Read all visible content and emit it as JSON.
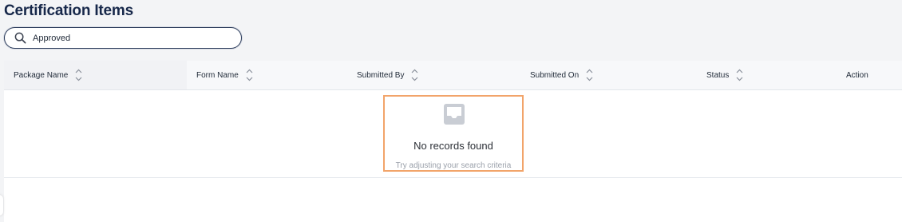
{
  "page": {
    "title": "Certification Items"
  },
  "search": {
    "value": "Approved"
  },
  "table": {
    "columns": [
      {
        "label": "Package Name",
        "sortable": true
      },
      {
        "label": "Form Name",
        "sortable": true
      },
      {
        "label": "Submitted By",
        "sortable": true
      },
      {
        "label": "Submitted On",
        "sortable": true
      },
      {
        "label": "Status",
        "sortable": true
      },
      {
        "label": "Action",
        "sortable": false
      }
    ],
    "rows": [],
    "empty": {
      "title": "No records found",
      "subtitle": "Try adjusting your search criteria",
      "icon": "inbox-icon"
    }
  },
  "colors": {
    "title": "#17284a",
    "empty_highlight": "#f2a46a",
    "background": "#f3f4f6"
  }
}
